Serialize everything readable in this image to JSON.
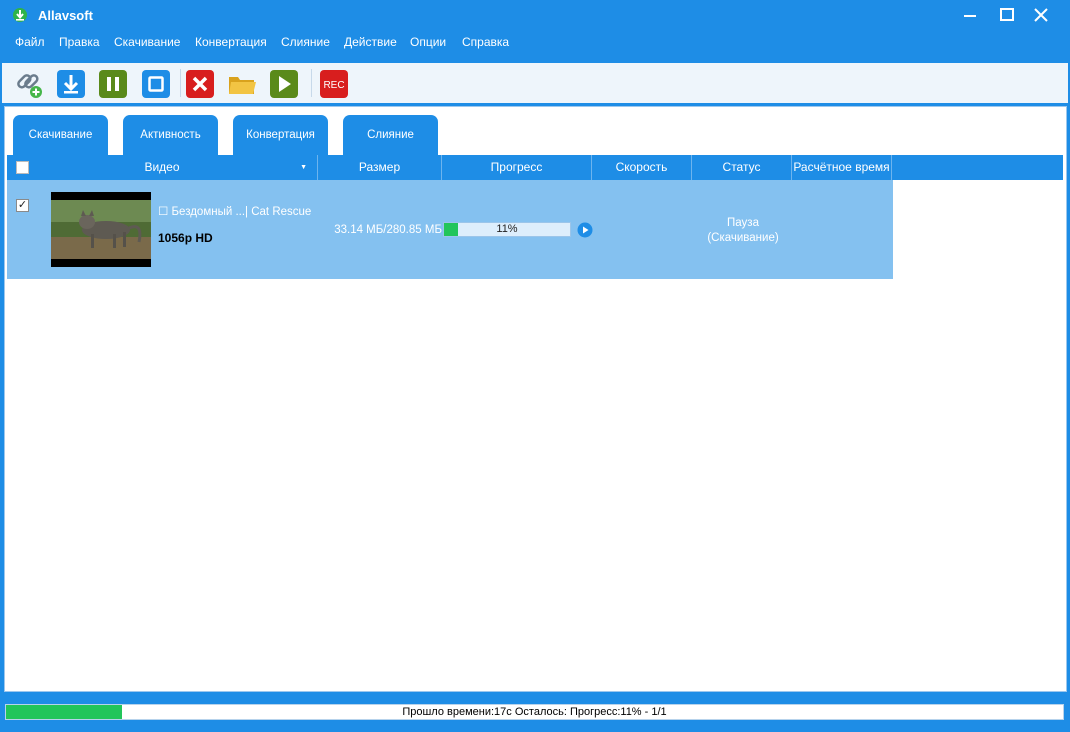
{
  "app": {
    "title": "Allavsoft"
  },
  "menu": {
    "items": [
      "Файл",
      "Правка",
      "Скачивание",
      "Конвертация",
      "Слияние",
      "Действие",
      "Опции",
      "Справка"
    ]
  },
  "toolbar": {
    "icons": [
      "add-link-icon",
      "download-icon",
      "pause-icon",
      "stop-icon",
      "delete-icon",
      "folder-icon",
      "play-icon",
      "rec-icon"
    ],
    "rec_label": "REC"
  },
  "tabs": [
    "Скачивание",
    "Активность",
    "Конвертация",
    "Слияние"
  ],
  "table": {
    "columns": [
      "Видео",
      "Размер",
      "Прогресс",
      "Скорость",
      "Статус",
      "Расчётное время"
    ],
    "rows": [
      {
        "checked": true,
        "check_mark": "✓",
        "title": "☐ Бездомный  ...| Cat Rescue",
        "quality": "1056p HD",
        "size": "33.14 МБ/280.85 МБ",
        "progress_percent": 11,
        "progress_label": "11%",
        "speed": "",
        "status_line1": "Пауза",
        "status_line2": "(Скачивание)",
        "eta": ""
      }
    ]
  },
  "statusbar": {
    "progress_percent": 11,
    "text": "Прошло времени:17с Осталось: Прогресс:11% - 1/1"
  },
  "colors": {
    "accent": "#1e8de6",
    "row_selected": "#84c1f0",
    "progress": "#22c55a",
    "rec": "#d81e1e"
  }
}
